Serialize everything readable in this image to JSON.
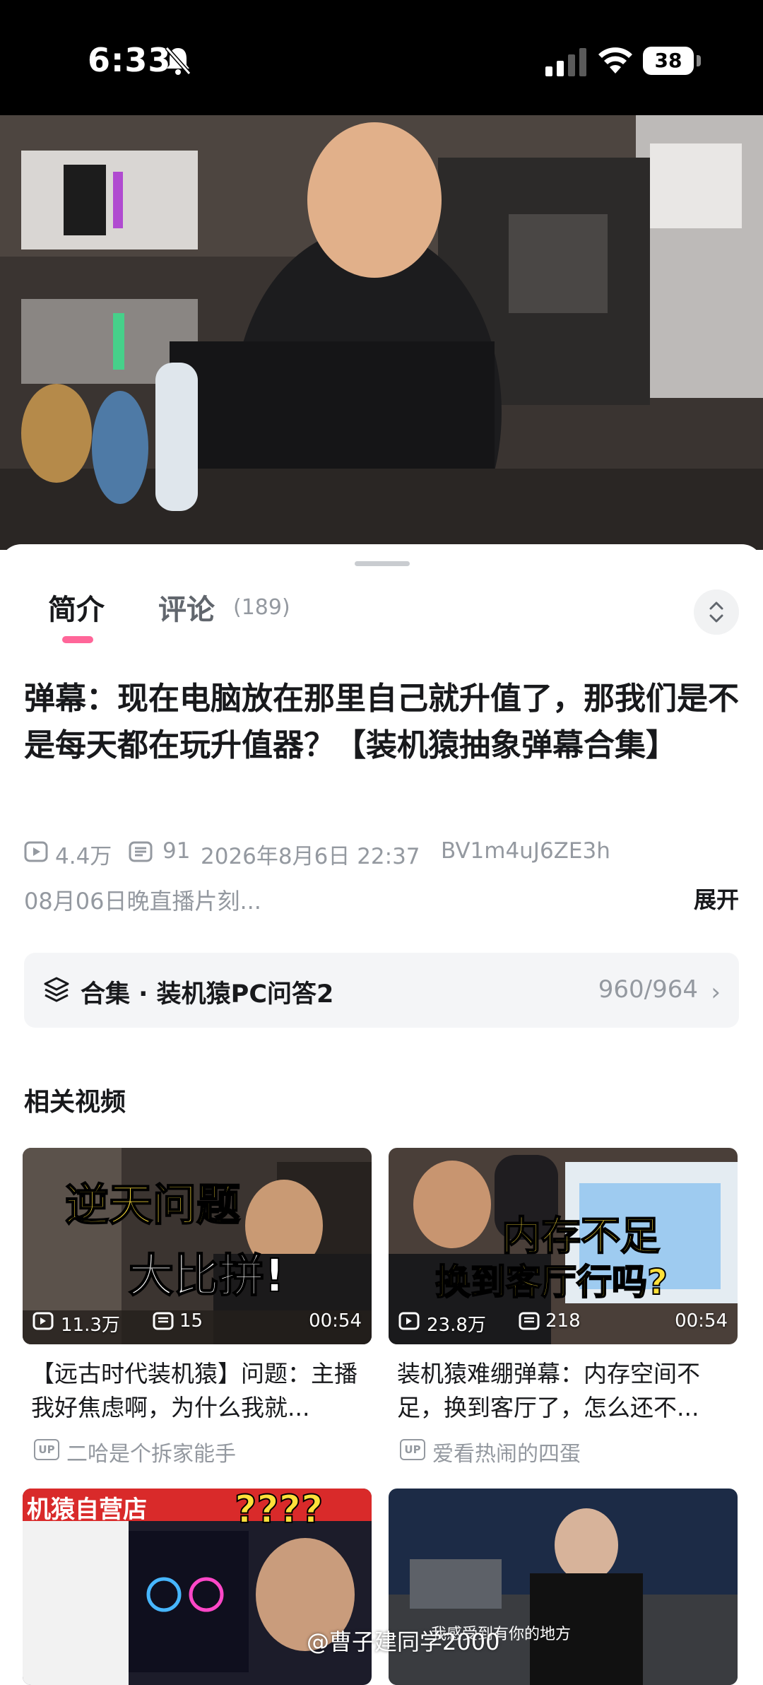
{
  "status_bar": {
    "time": "6:33",
    "battery": "38",
    "icons": [
      "bell-slash-icon",
      "cellular-signal-icon",
      "wifi-icon",
      "battery-icon"
    ]
  },
  "tabs": {
    "intro": "简介",
    "comments": "评论",
    "comments_count": "(189)",
    "accent_color": "#ff6699"
  },
  "video": {
    "title": "弹幕：现在电脑放在那里自己就升值了，那我们是不是每天都在玩升值器？【装机猿抽象弹幕合集】",
    "views": "4.4万",
    "danmaku": "91",
    "date": "2026年8月6日 22:37",
    "bvid": "BV1m4uJ6ZE3h",
    "description": "08月06日晚直播片刻...",
    "expand_label": "展开"
  },
  "collection": {
    "label": "合集 · 装机猿PC问答2",
    "progress": "960/964"
  },
  "related": {
    "section_title": "相关视频",
    "items": [
      {
        "thumb_text_1": "逆天问题",
        "thumb_text_2": "大比拼!",
        "views": "11.3万",
        "danmaku": "15",
        "duration": "00:54",
        "title": "【远古时代装机猿】问题：主播我好焦虑啊，为什么我就...",
        "author": "二哈是个拆家能手"
      },
      {
        "thumb_text_1": "内存不足",
        "thumb_text_2": "换到客厅行吗?",
        "views": "23.8万",
        "danmaku": "218",
        "duration": "00:54",
        "title": "装机猿难绷弹幕：内存空间不足，换到客厅了，怎么还不...",
        "author": "爱看热闹的四蛋"
      },
      {
        "thumb_text_1": "机猿自营店",
        "thumb_text_2": "????"
      },
      {
        "thumb_text_1": "我感受到有你的地方"
      }
    ]
  },
  "watermark": "@曹子建同学2000"
}
